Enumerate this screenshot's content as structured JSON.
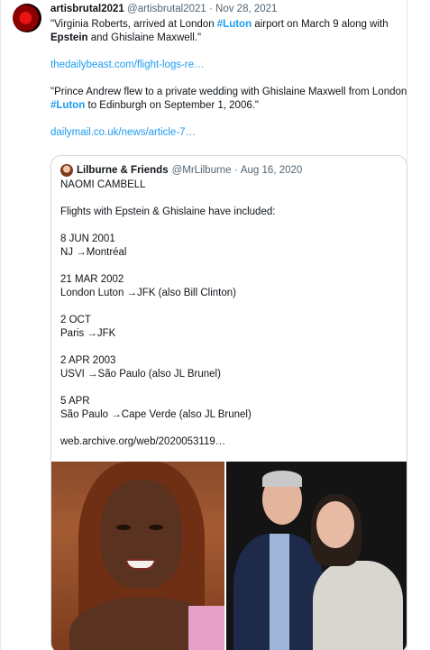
{
  "tweet": {
    "author_name": "artisbrutal2021",
    "author_handle": "@artisbrutal2021",
    "separator": "·",
    "date": "Nov 28, 2021",
    "para1_a": "\"Virginia Roberts, arrived at London ",
    "para1_hash": "#Luton",
    "para1_b": " airport on March 9 along with ",
    "para1_bold": "Epstein",
    "para1_c": " and Ghislaine Maxwell.\"",
    "link1": "thedailybeast.com/flight-logs-re…",
    "para2_a": "\"Prince Andrew flew to a private wedding with  Ghislaine Maxwell from London ",
    "para2_hash": "#Luton",
    "para2_b": " to Edinburgh on September 1, 2006.\"",
    "link2": "dailymail.co.uk/news/article-7…"
  },
  "quote": {
    "author_name": "Lilburne & Friends",
    "author_handle": "@MrLilburne",
    "separator": "·",
    "date": "Aug 16, 2020",
    "lines": [
      "NAOMI CAMBELL",
      "",
      "Flights with Epstein & Ghislaine have included:",
      "",
      "8 JUN 2001",
      "NJ →Montréal",
      "",
      "21 MAR 2002",
      "London Luton →JFK (also Bill Clinton)",
      "",
      "2 OCT",
      "Paris →JFK",
      "",
      "2 APR 2003",
      "USVI →São Paulo (also JL Brunel)",
      "",
      "5 APR",
      "São Paulo →Cape Verde (also JL Brunel)",
      "",
      "web.archive.org/web/2020053119…"
    ]
  },
  "media": {
    "left_image": "portrait-photo",
    "right_image": "couple-photo"
  }
}
